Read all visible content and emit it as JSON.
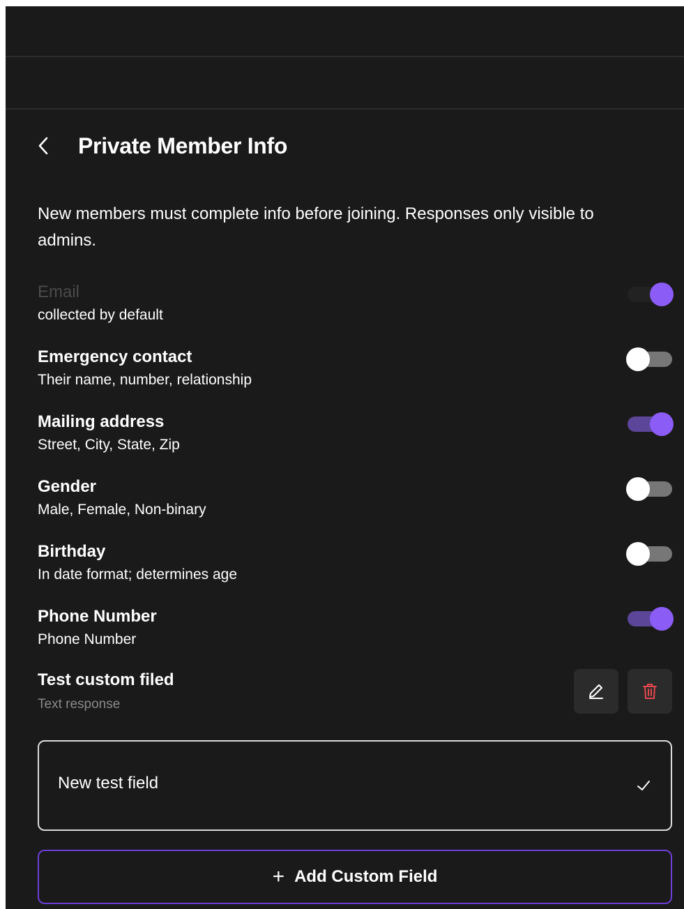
{
  "header": {
    "title": "Private Member Info"
  },
  "description": "New members must complete info before joining. Responses only visible to admins.",
  "fields": [
    {
      "label": "Email",
      "sub": "collected by default",
      "enabled": true,
      "locked": true
    },
    {
      "label": "Emergency contact",
      "sub": "Their name, number, relationship",
      "enabled": false
    },
    {
      "label": "Mailing address",
      "sub": "Street, City, State, Zip",
      "enabled": true
    },
    {
      "label": "Gender",
      "sub": "Male, Female, Non-binary",
      "enabled": false
    },
    {
      "label": "Birthday",
      "sub": "In date format; determines age",
      "enabled": false
    },
    {
      "label": "Phone Number",
      "sub": "Phone Number",
      "enabled": true
    }
  ],
  "custom_field": {
    "label": "Test custom filed",
    "type": "Text response"
  },
  "new_field_input": {
    "value": "New test field"
  },
  "add_button": {
    "plus": "+",
    "label": "Add Custom Field"
  },
  "colors": {
    "background": "#1a1a1a",
    "accent": "#8b5cf6",
    "accent_track": "#5b4699",
    "delete": "#e5484d",
    "add_border": "#6d3fd6"
  }
}
